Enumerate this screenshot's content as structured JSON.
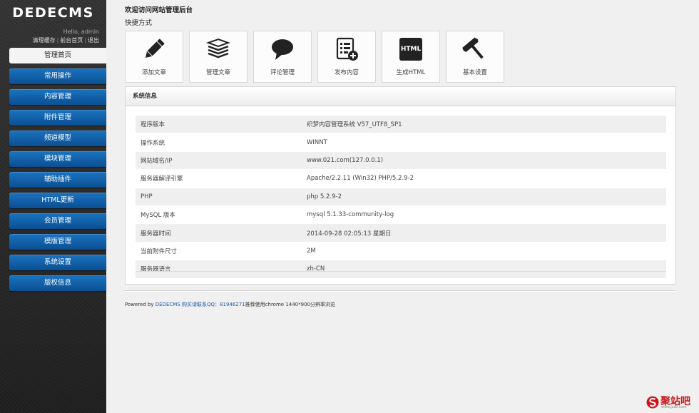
{
  "sidebar": {
    "logo": "DEDECMS",
    "hello": "Hello, admin",
    "links": [
      "清理缓存",
      "前台首页",
      "退出"
    ],
    "separator": "|",
    "menu": [
      {
        "label": "管理首页",
        "active": true
      },
      {
        "label": "常用操作"
      },
      {
        "label": "内容管理"
      },
      {
        "label": "附件管理"
      },
      {
        "label": "频道模型"
      },
      {
        "label": "模块管理"
      },
      {
        "label": "辅助插件"
      },
      {
        "label": "HTML更新"
      },
      {
        "label": "会员管理"
      },
      {
        "label": "模版管理"
      },
      {
        "label": "系统设置"
      },
      {
        "label": "版权信息"
      }
    ]
  },
  "main": {
    "welcome": "欢迎访问网站管理后台",
    "quick_title": "快捷方式",
    "shortcuts": [
      {
        "label": "添加文章",
        "icon": "pencil-icon"
      },
      {
        "label": "管理文章",
        "icon": "stack-icon"
      },
      {
        "label": "评论管理",
        "icon": "speech-bubble-icon"
      },
      {
        "label": "发布内容",
        "icon": "list-add-icon"
      },
      {
        "label": "生成HTML",
        "icon": "html-icon",
        "icon_text": "HTML"
      },
      {
        "label": "基本设置",
        "icon": "hammer-icon"
      }
    ],
    "sysinfo": {
      "title": "系统信息",
      "rows": [
        {
          "key": "程序版本",
          "value": "织梦内容管理系统 V57_UTF8_SP1"
        },
        {
          "key": "操作系统",
          "value": "WINNT"
        },
        {
          "key": "网站域名/IP",
          "value": "www.021.com(127.0.0.1)"
        },
        {
          "key": "服务器解译引擎",
          "value": "Apache/2.2.11 (Win32) PHP/5.2.9-2"
        },
        {
          "key": "PHP",
          "value": "php 5.2.9-2"
        },
        {
          "key": "MySQL 版本",
          "value": "mysql 5.1.33-community-log"
        },
        {
          "key": "服务器时间",
          "value": "2014-09-28 02:05:13 星期日"
        },
        {
          "key": "当前附件尺寸",
          "value": "2M"
        },
        {
          "key": "服务器语言",
          "value": "zh-CN"
        }
      ]
    },
    "footer": {
      "prefix": "Powered by ",
      "link": "DEDECMS 购买请联系QQ：81946271",
      "suffix": "推荐使用chrome 1440*900分辨率浏览"
    }
  },
  "watermark": {
    "text": "聚站吧",
    "sub": "www.jzz8.com"
  },
  "colors": {
    "menu_blue": "#0b4f92",
    "sidebar_bg": "#2b2b2b",
    "link": "#1a5aa6",
    "watermark_red": "#c8181e"
  }
}
